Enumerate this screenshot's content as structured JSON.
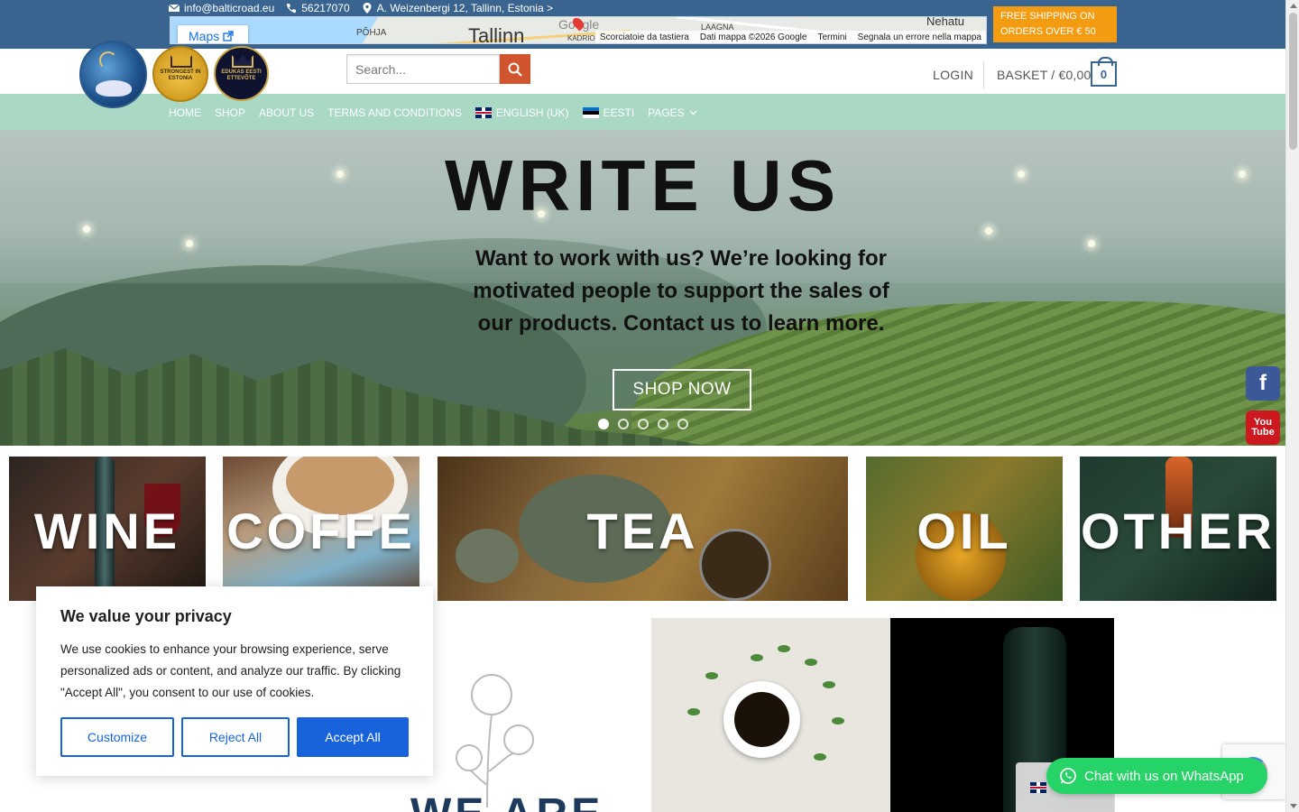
{
  "topbar": {
    "email": "info@balticroad.eu",
    "phone": "56217070",
    "address": "A. Weizenbergi 12, Tallinn, Estonia >",
    "free_shipping": "FREE SHIPPING ON ORDERS OVER € 50"
  },
  "map": {
    "maps_button": "Maps",
    "city": "Tallinn",
    "labels": [
      "PÕHJA",
      "LAAGNA",
      "Nehatu",
      "KADRIO"
    ],
    "google": "Google",
    "footer": [
      "Scorciatoie da tastiera",
      "Dati mappa ©2026 Google",
      "Termini",
      "Segnala un errore nella mappa"
    ]
  },
  "header": {
    "badge1": "STRONGEST IN ESTONIA",
    "badge2": "EDUKAS EESTI ETTEVÕTE",
    "search_placeholder": "Search...",
    "login": "LOGIN",
    "basket": "BASKET / €0,00",
    "basket_count": "0"
  },
  "nav": {
    "items": [
      "HOME",
      "SHOP",
      "ABOUT US",
      "TERMS AND CONDITIONS"
    ],
    "lang_en": "ENGLISH (UK)",
    "lang_ee": "EESTI",
    "pages": "PAGES"
  },
  "hero": {
    "title": "WRITE US",
    "subtitle": "Want to work with us? We’re looking for motivated people to support the sales of our products. Contact us to learn more.",
    "button": "SHOP NOW",
    "slides": 5,
    "active_slide": 1
  },
  "social": {
    "facebook": "f",
    "youtube_top": "You",
    "youtube_bottom": "Tube"
  },
  "categories": [
    {
      "label": "WINE"
    },
    {
      "label": "COFFE"
    },
    {
      "label": "TEA"
    },
    {
      "label": "OIL"
    },
    {
      "label": "OTHER"
    }
  ],
  "below": {
    "heading": "WE ARE"
  },
  "cookie": {
    "title": "We value your privacy",
    "text": "We use cookies to enhance your browsing experience, serve personalized ads or content, and analyze our traffic. By clicking \"Accept All\", you consent to our use of cookies.",
    "customize": "Customize",
    "reject": "Reject All",
    "accept": "Accept All"
  },
  "whatsapp": {
    "label": "Chat with us on WhatsApp"
  },
  "colors": {
    "topbar": "#3a6490",
    "shipping": "#f39c12",
    "nav": "#a9d8c5",
    "search_button": "#d0552e",
    "cookie_primary": "#1863dc",
    "whatsapp": "#25d366"
  },
  "icons": [
    "envelope-icon",
    "phone-icon",
    "map-marker-icon",
    "search-icon",
    "external-link-icon",
    "chevron-down-icon",
    "facebook-icon",
    "youtube-icon",
    "whatsapp-icon"
  ]
}
